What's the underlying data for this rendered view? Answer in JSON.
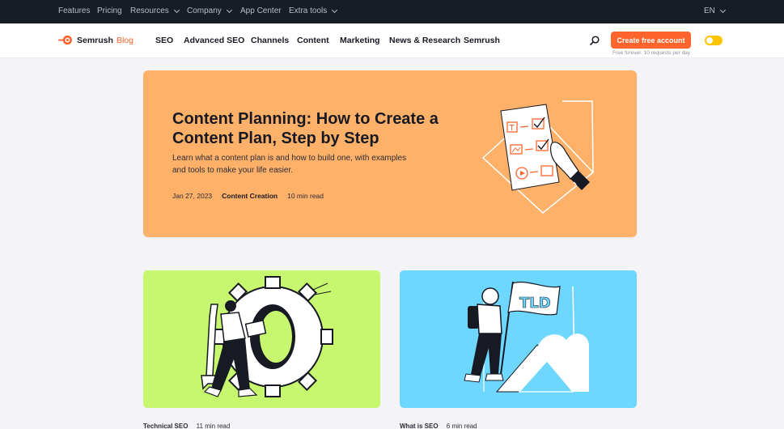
{
  "topbar": {
    "items": [
      {
        "label": "Features",
        "has_dropdown": false
      },
      {
        "label": "Pricing",
        "has_dropdown": false
      },
      {
        "label": "Resources",
        "has_dropdown": true
      },
      {
        "label": "Company",
        "has_dropdown": true
      },
      {
        "label": "App Center",
        "has_dropdown": false
      },
      {
        "label": "Extra tools",
        "has_dropdown": true
      }
    ],
    "language": "EN"
  },
  "navbar": {
    "brand": "Semrush",
    "brand_suffix": "Blog",
    "items": [
      "SEO",
      "Advanced SEO",
      "Channels",
      "Content",
      "Marketing",
      "News & Research",
      "Semrush"
    ],
    "cta_label": "Create free account",
    "cta_sub": "Free forever. 10 requests per day",
    "accent": "#ff642d",
    "toggle_color": "#ffc400"
  },
  "hero": {
    "title": "Content Planning: How to Create a Content Plan, Step by Step",
    "description": "Learn what a content plan is and how to build one, with examples and tools to make your life easier.",
    "date": "Jan 27, 2023",
    "category": "Content Creation",
    "read_time": "10 min read",
    "background": "#ffb069"
  },
  "cards": [
    {
      "category": "Technical SEO",
      "read_time": "11 min read",
      "background": "#c7f76e",
      "illustration": "person-with-gear-and-wrench"
    },
    {
      "category": "What is SEO",
      "read_time": "6 min read",
      "background": "#6dd7ff",
      "illustration": "hiker-with-tld-flag"
    }
  ]
}
